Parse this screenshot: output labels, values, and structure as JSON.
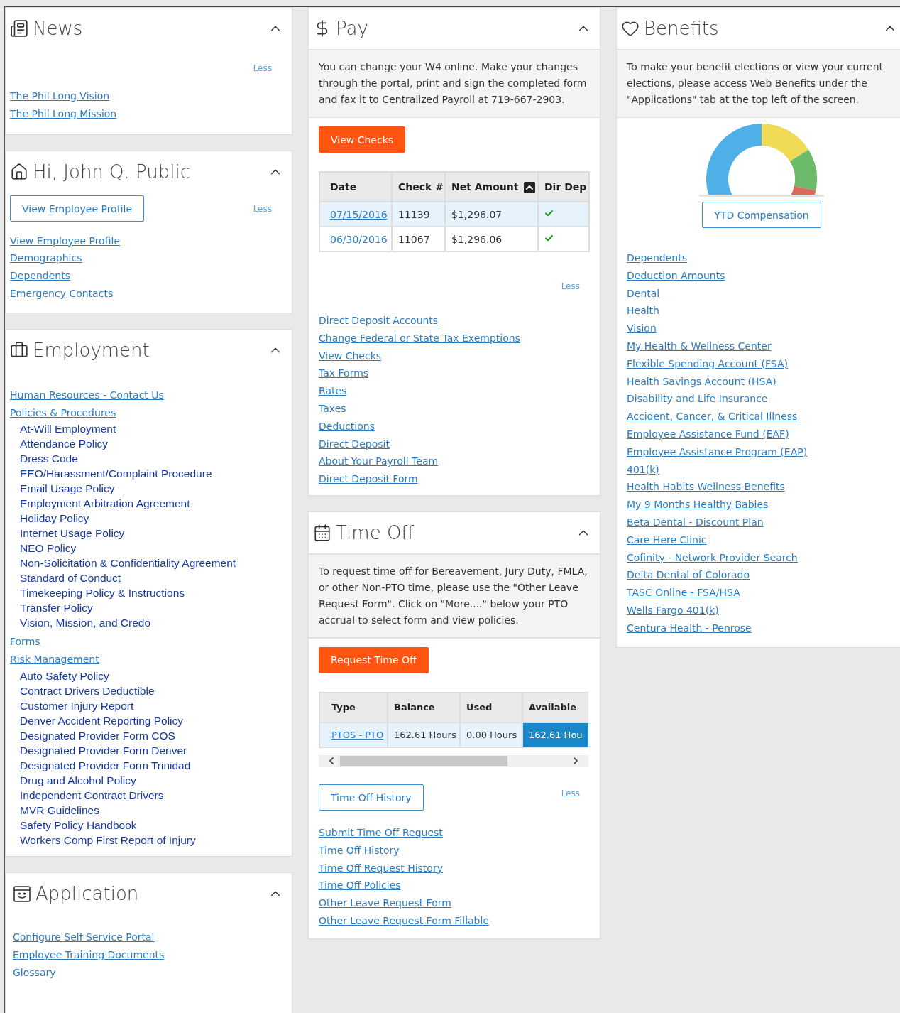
{
  "news": {
    "title": "News",
    "expanded": true,
    "less": "Less",
    "links": [
      "The Phil Long Vision",
      "The Phil Long Mission"
    ]
  },
  "greeting": {
    "title": "Hi, John Q. Public",
    "expanded": true,
    "button": "View Employee Profile",
    "less": "Less",
    "links": [
      "View Employee Profile",
      "Demographics",
      "Dependents",
      "Emergency Contacts"
    ]
  },
  "employment": {
    "title": "Employment",
    "expanded": true,
    "items": [
      {
        "label": "Human Resources - Contact Us"
      },
      {
        "label": "Policies & Procedures",
        "children": [
          "At-Will Employment",
          "Attendance Policy",
          "Dress Code",
          "EEO/Harassment/Complaint Procedure",
          "Email Usage Policy",
          "Employment Arbitration Agreement",
          "Holiday Policy",
          "Internet Usage Policy",
          "NEO Policy",
          "Non-Solicitation & Confidentiality Agreement",
          "Standard of Conduct",
          "Timekeeping Policy & Instructions",
          "Transfer Policy",
          "Vision, Mission, and Credo"
        ]
      },
      {
        "label": "Forms"
      },
      {
        "label": "Risk Management",
        "children": [
          "Auto Safety Policy",
          "Contract Drivers Deductible",
          "Customer Injury Report",
          "Denver Accident Reporting Policy",
          "Designated Provider Form COS",
          "Designated Provider Form Denver",
          "Designated Provider Form Trinidad",
          "Drug and Alcohol Policy",
          "Independent Contract Drivers",
          "MVR Guidelines",
          "Safety Policy Handbook",
          "Workers Comp First Report of Injury"
        ]
      }
    ]
  },
  "application": {
    "title": "Application",
    "expanded": true,
    "links": [
      "Configure Self Service Portal",
      "Employee Training Documents",
      "Glossary"
    ]
  },
  "pay": {
    "title": "Pay",
    "expanded": true,
    "notice": "You can change your W4 online. Make your changes through the portal, print and sign the completed form and fax it to Centralized Payroll at 719-667-2903.",
    "button": "View Checks",
    "columns": [
      {
        "label": "Date",
        "sorted": false
      },
      {
        "label": "Check #",
        "sorted": false
      },
      {
        "label": "Net Amount",
        "sorted": true
      },
      {
        "label": "Dir Dep",
        "sorted": false
      }
    ],
    "rows": [
      {
        "date": "07/15/2016",
        "check": "11139",
        "amount": "$1,296.07",
        "dir_dep": true,
        "selected": true
      },
      {
        "date": "06/30/2016",
        "check": "11067",
        "amount": "$1,296.06",
        "dir_dep": true,
        "selected": false
      }
    ],
    "less": "Less",
    "links": [
      "Direct Deposit Accounts",
      "Change Federal or State Tax Exemptions",
      "View Checks",
      "Tax Forms",
      "Rates",
      "Taxes",
      "Deductions",
      "Direct Deposit",
      "About Your Payroll Team",
      "Direct Deposit Form"
    ]
  },
  "time_off": {
    "title": "Time Off",
    "expanded": true,
    "notice": "To request time off for Bereavement, Jury Duty, FMLA, or other Non-PTO time, please use the \"Other Leave Request Form\". Click on \"More....\" below your PTO accrual to select form and view policies.",
    "button": "Request Time Off",
    "columns": [
      "Type",
      "Balance",
      "Used",
      "Available"
    ],
    "rows": [
      {
        "selected": true,
        "cells": [
          {
            "kind": "link",
            "text": "PTOS - PTO"
          },
          {
            "kind": "text",
            "text": "162.61 Hours"
          },
          {
            "kind": "text",
            "text": "0.00 Hours"
          },
          {
            "kind": "active",
            "text": "162.61 Hou"
          }
        ]
      }
    ],
    "history_button": "Time Off History",
    "less": "Less",
    "links": [
      "Submit Time Off Request",
      "Time Off History",
      "Time Off Request History",
      "Time Off Policies",
      "Other Leave Request Form",
      "Other Leave Request Form Fillable"
    ]
  },
  "benefits": {
    "title": "Benefits",
    "expanded": true,
    "notice": "To make your benefit elections or view your current elections, please access Web Benefits under the \"Applications\" tab at the top left of the screen.",
    "button": "YTD Compensation",
    "links": [
      "Dependents",
      "Deduction Amounts",
      "Dental",
      "Health",
      "Vision",
      "My Health & Wellness Center",
      "Flexible Spending Account (FSA)",
      "Health Savings Account (HSA)",
      "Disability and Life Insurance",
      "Accident, Cancer, & Critical Illness",
      "Employee Assistance Fund (EAF)",
      "Employee Assistance Program (EAP)",
      "401(k)",
      "Health Habits Wellness Benefits",
      "My 9 Months Healthy Babies",
      "Beta Dental - Discount Plan",
      "Care Here Clinic",
      "Cofinity - Network Provider Search",
      "Delta Dental of Colorado",
      "TASC Online - FSA/HSA",
      "Wells Fargo 401(k)",
      "Centura Health - Penrose"
    ]
  }
}
